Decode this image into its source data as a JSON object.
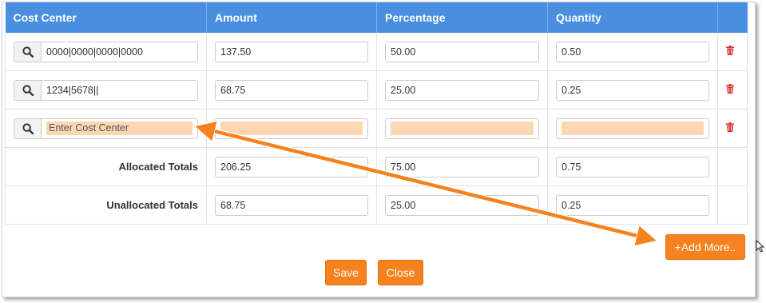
{
  "headers": [
    "Cost Center",
    "Amount",
    "Percentage",
    "Quantity",
    ""
  ],
  "rows": [
    {
      "cost_center": "0000|0000|0000|0000",
      "amount": "137.50",
      "percentage": "50.00",
      "quantity": "0.50"
    },
    {
      "cost_center": "1234|5678||",
      "amount": "68.75",
      "percentage": "25.00",
      "quantity": "0.25"
    },
    {
      "cost_center": "",
      "cost_center_placeholder": "Enter Cost Center",
      "amount": "",
      "percentage": "",
      "quantity": ""
    }
  ],
  "totals": {
    "allocated": {
      "label": "Allocated Totals",
      "amount": "206.25",
      "percentage": "75.00",
      "quantity": "0.75"
    },
    "unallocated": {
      "label": "Unallocated Totals",
      "amount": "68.75",
      "percentage": "25.00",
      "quantity": "0.25"
    }
  },
  "buttons": {
    "add_more": "+Add More..",
    "save": "Save",
    "close": "Close"
  },
  "icons": {
    "search": "search-icon",
    "delete": "trash-icon"
  },
  "colors": {
    "header_bg": "#4a8ee0",
    "button_bg": "#f5821f",
    "highlight": "#fcd7b1",
    "delete_icon": "#d9302c",
    "annotation_arrow": "#f5821f"
  }
}
